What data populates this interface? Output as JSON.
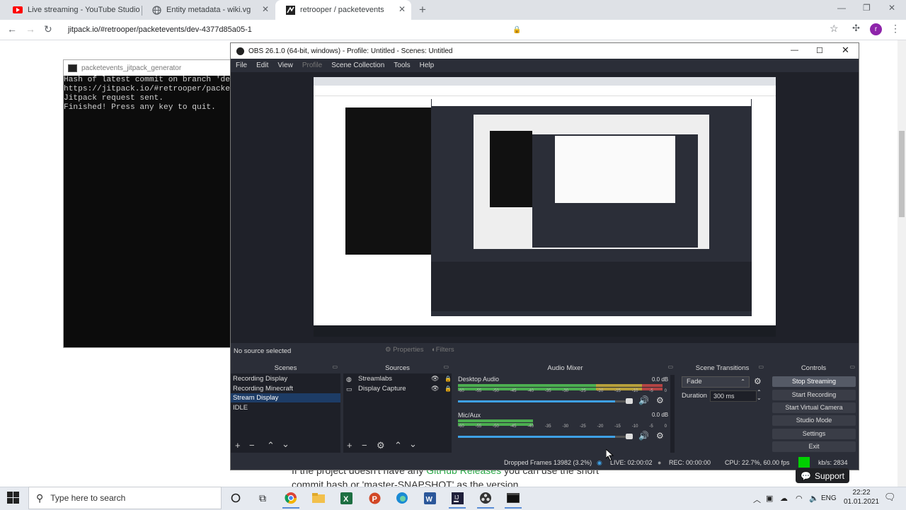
{
  "browser": {
    "tabs": [
      {
        "title": "Live streaming - YouTube Studio",
        "active": false,
        "icon": "youtube-icon"
      },
      {
        "title": "Entity metadata - wiki.vg",
        "active": false,
        "icon": "globe-icon"
      },
      {
        "title": "retrooper / packetevents",
        "active": true,
        "icon": "jitpack-icon"
      }
    ],
    "url": "jitpack.io/#retrooper/packetevents/dev-4377d85a05-1",
    "profile_initial": "r"
  },
  "page": {
    "text_line1_pre": "If the project doesn't have any ",
    "text_line1_link": "GitHub Releases",
    "text_line1_post": " you can use the short",
    "text_line2": "commit hash or 'master-SNAPSHOT' as the version",
    "support_label": "Support"
  },
  "console": {
    "title": "packetevents_jitpack_generator",
    "lines": [
      "Hash of latest commit on branch 'dev'",
      "https://jitpack.io/#retrooper/packete",
      "Jitpack request sent.",
      "Finished! Press any key to quit."
    ]
  },
  "obs": {
    "title": "OBS 26.1.0 (64-bit, windows) - Profile: Untitled - Scenes: Untitled",
    "menu": [
      "File",
      "Edit",
      "View",
      "Profile",
      "Scene Collection",
      "Tools",
      "Help"
    ],
    "no_source": "No source selected",
    "properties_label": "Properties",
    "filters_label": "Filters",
    "docks": {
      "scenes": "Scenes",
      "sources": "Sources",
      "mixer": "Audio Mixer",
      "transitions": "Scene Transitions",
      "controls": "Controls"
    },
    "scenes": [
      "Recording Display",
      "Recording Minecraft",
      "Stream Display",
      "IDLE"
    ],
    "selected_scene": "Stream Display",
    "sources": [
      "Streamlabs",
      "Display Capture"
    ],
    "mixer": [
      {
        "name": "Desktop Audio",
        "db": "0.0 dB",
        "level": 0.98,
        "volume": 0.9
      },
      {
        "name": "Mic/Aux",
        "db": "0.0 dB",
        "level": 0.36,
        "volume": 0.9
      }
    ],
    "meter_scale": [
      "-60",
      "-55",
      "-50",
      "-45",
      "-40",
      "-35",
      "-30",
      "-25",
      "-20",
      "-15",
      "-10",
      "-5",
      "0"
    ],
    "transition": "Fade",
    "duration_label": "Duration",
    "duration_value": "300 ms",
    "controls": [
      "Stop Streaming",
      "Start Recording",
      "Start Virtual Camera",
      "Studio Mode",
      "Settings",
      "Exit"
    ],
    "status": {
      "dropped": "Dropped Frames 13982 (3.2%)",
      "live": "LIVE: 02:00:02",
      "rec": "REC: 00:00:00",
      "cpu": "CPU: 22.7%, 60.00 fps",
      "kbs": "kb/s: 2834"
    }
  },
  "taskbar": {
    "search_placeholder": "Type here to search",
    "lang": "ENG",
    "time": "22:22",
    "date": "01.01.2021"
  },
  "colors": {
    "obs_bg": "#2b2e38",
    "selected": "#1d3c66",
    "accent_blue": "#3ea1e6",
    "link_green": "#28a745",
    "live_green": "#00d000"
  }
}
